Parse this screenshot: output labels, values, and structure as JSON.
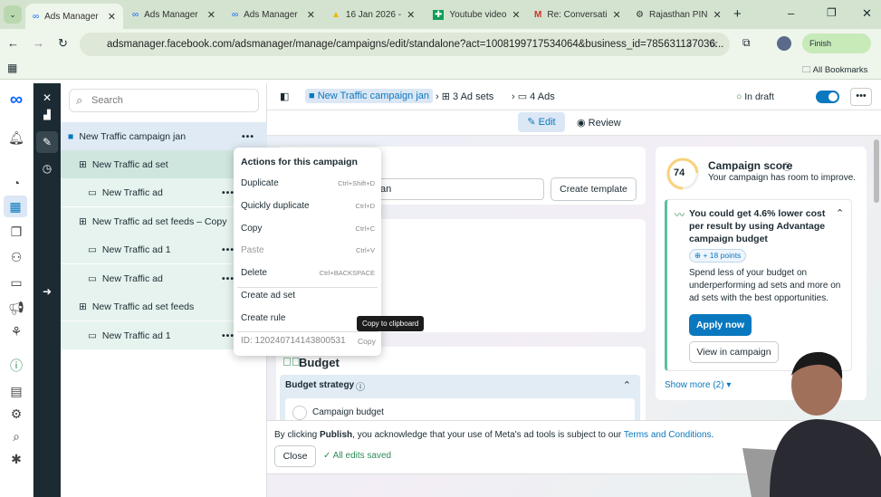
{
  "browser": {
    "tabs": [
      {
        "title": "Ads Manager",
        "icon": "meta-icon",
        "active": true
      },
      {
        "title": "Ads Manager",
        "icon": "meta-icon"
      },
      {
        "title": "Ads Manager",
        "icon": "meta-icon"
      },
      {
        "title": "16 Jan 2026 -",
        "icon": "google-drive-icon"
      },
      {
        "title": "Youtube video",
        "icon": "google-sheets-icon"
      },
      {
        "title": "Re: Conversati",
        "icon": "gmail-icon"
      },
      {
        "title": "Rajasthan PIN",
        "icon": "chatgpt-icon"
      }
    ],
    "url": "adsmanager.facebook.com/adsmanager/manage/campaigns/edit/standalone?act=1008199717534064&business_id=785631137036...",
    "profile_label": "Finish",
    "bookmarks_label": "All Bookmarks"
  },
  "tree": {
    "search_placeholder": "Search",
    "items": [
      {
        "label": "New Traffic campaign jan",
        "type": "campaign"
      },
      {
        "label": "New Traffic ad set",
        "type": "adset"
      },
      {
        "label": "New Traffic ad",
        "type": "ad"
      },
      {
        "label": "New Traffic ad set feeds – Copy",
        "type": "adset"
      },
      {
        "label": "New Traffic ad 1",
        "type": "ad"
      },
      {
        "label": "New Traffic ad",
        "type": "ad"
      },
      {
        "label": "New Traffic ad set feeds",
        "type": "adset"
      },
      {
        "label": "New Traffic ad 1",
        "type": "ad"
      }
    ]
  },
  "header": {
    "campaign": "New Traffic campaign jan",
    "adsets": "3 Ad sets",
    "ads": "4 Ads",
    "status": "In draft",
    "edit": "Edit",
    "review": "Review"
  },
  "menu": {
    "title": "Actions for this campaign",
    "items": [
      {
        "label": "Duplicate",
        "shortcut": "Ctrl+Shift+D"
      },
      {
        "label": "Quickly duplicate",
        "shortcut": "Ctrl+D"
      },
      {
        "label": "Copy",
        "shortcut": "Ctrl+C"
      },
      {
        "label": "Paste",
        "shortcut": "Ctrl+V",
        "disabled": true
      },
      {
        "label": "Delete",
        "shortcut": "Ctrl+BACKSPACE"
      },
      {
        "label": "Create ad set"
      },
      {
        "label": "Create rule"
      }
    ],
    "id": "ID: 120240714143800531",
    "copy": "Copy",
    "tooltip": "Copy to clipboard"
  },
  "form": {
    "name_value_fragment": "an",
    "create_template": "Create template",
    "budget_title": "Budget",
    "budget_strategy": "Budget strategy",
    "campaign_budget": "Campaign budget"
  },
  "score": {
    "value": "74",
    "score_fraction": 0.74,
    "title": "Campaign score",
    "subtitle": "Your campaign has room to improve.",
    "rec_title": "You could get 4.6% lower cost per result by using Advantage campaign budget",
    "points": "+ 18 points",
    "rec_body": "Spend less of your budget on underperforming ad sets and more on ad sets with the best opportunities.",
    "apply": "Apply now",
    "view": "View in campaign",
    "show_more": "Show more (2)"
  },
  "footer": {
    "prefix": "By clicking ",
    "publish": "Publish",
    "middle": ", you acknowledge that your use of Meta's ad tools is subject to our ",
    "terms": "Terms and Conditions",
    "suffix": ".",
    "close": "Close",
    "saved": "All edits saved"
  },
  "colors": {
    "accent": "#0a78be",
    "tree_bg": "#e6f3ee",
    "dark_rail": "#1c2b33",
    "success": "#2e8b57"
  }
}
